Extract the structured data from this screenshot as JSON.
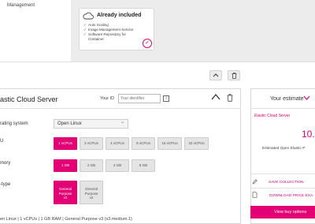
{
  "top": {
    "management_label": "Management",
    "included_card": {
      "title": "Already included",
      "features": [
        "Auto Scaling",
        "Image Management Service",
        "Software Repository for",
        "Container"
      ]
    }
  },
  "config": {
    "title": "astic Cloud Server",
    "your_id_label": "Your ID",
    "your_id_placeholder": "Your identifier",
    "info_glyph": "i",
    "rows": {
      "os_label": "rating system",
      "os_value": "Open Linux",
      "vcpu_label": "U",
      "ram_label": "mory",
      "flavor_label": "-type"
    },
    "vcpu_options": [
      "1 vCPUs",
      "2 vCPUs",
      "4 vCPUs",
      "8 vCPUs",
      "16 vCPUs",
      "32 vCPUs"
    ],
    "ram_options": [
      "1 GB",
      "2 GB",
      "4 GB",
      "8 GB"
    ],
    "flavor_options": [
      [
        "General",
        "Purpose",
        "v3"
      ],
      [
        "General",
        "Purpose",
        "v2"
      ]
    ],
    "summary": "en Linux | 1 vCPUs | 1 GB RAM | General Purpose v3 (s3.medium.1)"
  },
  "estimate": {
    "title": "Your estimate",
    "product": "Elastic Cloud Server",
    "price": "10.",
    "price_label": "Estimated Open Elastic P",
    "save_link": "SAVE COLLECTION",
    "download_link": "DOWNLOAD PRICE EXA",
    "buy_button": "View buy options"
  },
  "colors": {
    "accent": "#e20074",
    "panel_gray": "#ececec"
  }
}
